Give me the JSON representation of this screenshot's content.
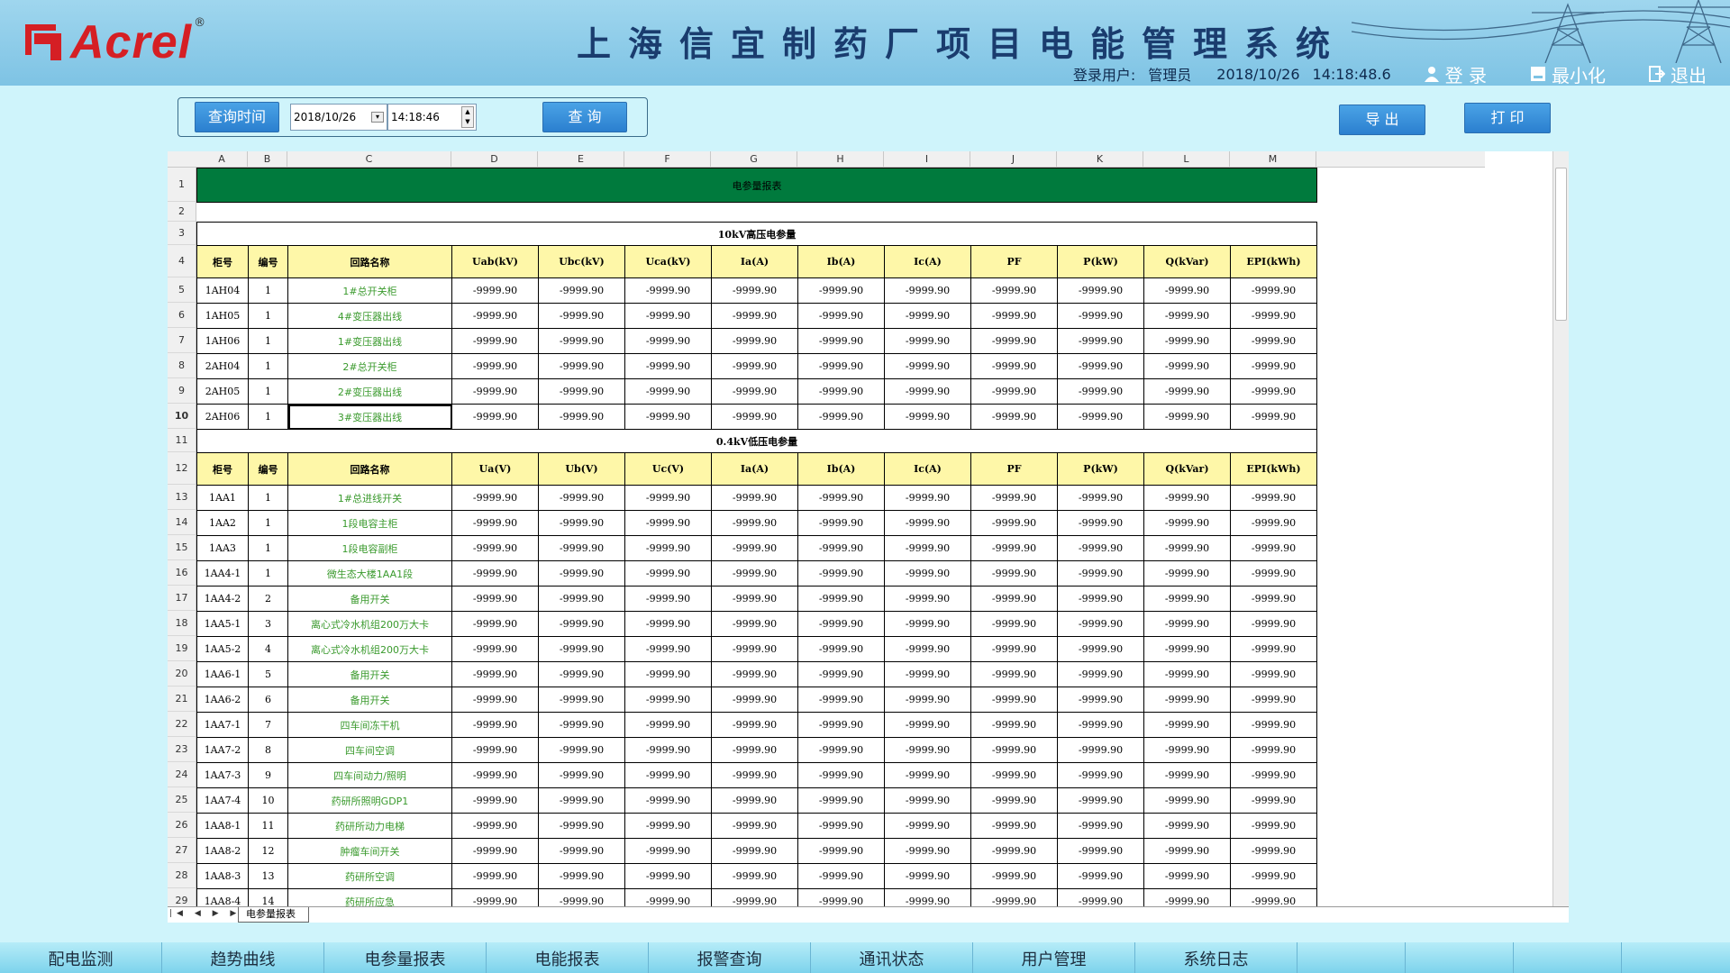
{
  "header": {
    "brand": "Acrel",
    "reg": "®",
    "title": "上海信宜制药厂项目电能管理系统",
    "user_label": "登录用户:",
    "user_name": "管理员",
    "date": "2018/10/26",
    "time": "14:18:48.6",
    "login": "登 录",
    "minimize": "最小化",
    "exit": "退出"
  },
  "query": {
    "label_btn": "查询时间",
    "date_value": "2018/10/26",
    "time_value": "14:18:46",
    "query_btn": "查 询",
    "export_btn": "导 出",
    "print_btn": "打 印"
  },
  "sheet": {
    "columns": [
      "A",
      "B",
      "C",
      "D",
      "E",
      "F",
      "G",
      "H",
      "I",
      "J",
      "K",
      "L",
      "M"
    ],
    "report_title": "电参量报表",
    "hv_title": "10kV高压电参量",
    "lv_title": "0.4kV低压电参量",
    "hv_headers": [
      "柜号",
      "编号",
      "回路名称",
      "Uab(kV)",
      "Ubc(kV)",
      "Uca(kV)",
      "Ia(A)",
      "Ib(A)",
      "Ic(A)",
      "PF",
      "P(kW)",
      "Q(kVar)",
      "EPI(kWh)"
    ],
    "lv_headers": [
      "柜号",
      "编号",
      "回路名称",
      "Ua(V)",
      "Ub(V)",
      "Uc(V)",
      "Ia(A)",
      "Ib(A)",
      "Ic(A)",
      "PF",
      "P(kW)",
      "Q(kVar)",
      "EPI(kWh)"
    ],
    "value": "-9999.90",
    "hv_rows": [
      {
        "cab": "1AH04",
        "no": "1",
        "name": "1#总开关柜"
      },
      {
        "cab": "1AH05",
        "no": "1",
        "name": "4#变压器出线"
      },
      {
        "cab": "1AH06",
        "no": "1",
        "name": "1#变压器出线"
      },
      {
        "cab": "2AH04",
        "no": "1",
        "name": "2#总开关柜"
      },
      {
        "cab": "2AH05",
        "no": "1",
        "name": "2#变压器出线"
      },
      {
        "cab": "2AH06",
        "no": "1",
        "name": "3#变压器出线"
      }
    ],
    "lv_rows": [
      {
        "cab": "1AA1",
        "no": "1",
        "name": "1#总进线开关"
      },
      {
        "cab": "1AA2",
        "no": "1",
        "name": "1段电容主柜"
      },
      {
        "cab": "1AA3",
        "no": "1",
        "name": "1段电容副柜"
      },
      {
        "cab": "1AA4-1",
        "no": "1",
        "name": "微生态大楼1AA1段"
      },
      {
        "cab": "1AA4-2",
        "no": "2",
        "name": "备用开关"
      },
      {
        "cab": "1AA5-1",
        "no": "3",
        "name": "离心式冷水机组200万大卡"
      },
      {
        "cab": "1AA5-2",
        "no": "4",
        "name": "离心式冷水机组200万大卡"
      },
      {
        "cab": "1AA6-1",
        "no": "5",
        "name": "备用开关"
      },
      {
        "cab": "1AA6-2",
        "no": "6",
        "name": "备用开关"
      },
      {
        "cab": "1AA7-1",
        "no": "7",
        "name": "四车间冻干机"
      },
      {
        "cab": "1AA7-2",
        "no": "8",
        "name": "四车间空调"
      },
      {
        "cab": "1AA7-3",
        "no": "9",
        "name": "四车间动力/照明"
      },
      {
        "cab": "1AA7-4",
        "no": "10",
        "name": "药研所照明GDP1"
      },
      {
        "cab": "1AA8-1",
        "no": "11",
        "name": "药研所动力电梯"
      },
      {
        "cab": "1AA8-2",
        "no": "12",
        "name": "肿瘤车间开关"
      },
      {
        "cab": "1AA8-3",
        "no": "13",
        "name": "药研所空调"
      },
      {
        "cab": "1AA8-4",
        "no": "14",
        "name": "药研所应急"
      }
    ],
    "tab_name": "电参量报表"
  },
  "nav": [
    "配电监测",
    "趋势曲线",
    "电参量报表",
    "电能报表",
    "报警查询",
    "通讯状态",
    "用户管理",
    "系统日志"
  ],
  "colors": {
    "accent": "#2b7fcf",
    "title_bar": "#007a3d",
    "header_row": "#fef7a8",
    "name_text": "#3a9a2d",
    "logo": "#d51f24"
  }
}
